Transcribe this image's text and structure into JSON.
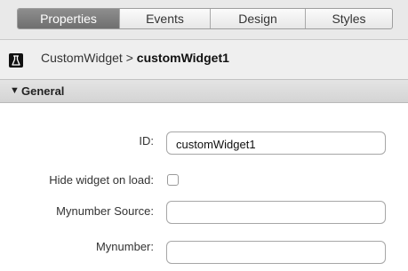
{
  "tabs": [
    {
      "label": "Properties",
      "active": true
    },
    {
      "label": "Events",
      "active": false
    },
    {
      "label": "Design",
      "active": false
    },
    {
      "label": "Styles",
      "active": false
    }
  ],
  "breadcrumb": {
    "icon": "flask-icon",
    "parent": "CustomWidget",
    "separator": " > ",
    "current": "customWidget1"
  },
  "section": {
    "title": "General",
    "expanded": true
  },
  "fields": {
    "id": {
      "label": "ID:",
      "value": "customWidget1"
    },
    "hide_on_load": {
      "label": "Hide widget on load:",
      "checked": false
    },
    "mynumber_source": {
      "label": "Mynumber Source:",
      "value": ""
    },
    "mynumber": {
      "label": "Mynumber:",
      "value": ""
    }
  },
  "colors": {
    "active_tab": "#7f7f7f",
    "toolbar_bg": "#e9e9e9"
  }
}
